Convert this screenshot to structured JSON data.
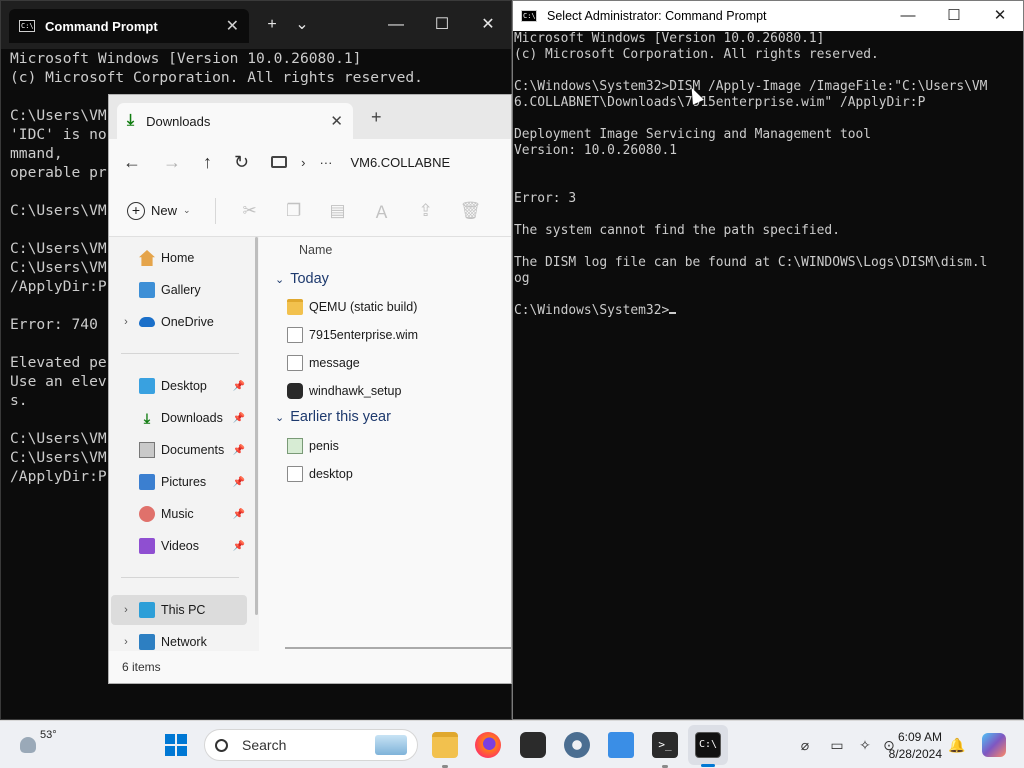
{
  "left_terminal": {
    "tab_title": "Command Prompt",
    "new_tab_glyph": "+",
    "dropdown_glyph": "⌄",
    "lines": [
      "Microsoft Windows [Version 10.0.26080.1]",
      "(c) Microsoft Corporation. All rights reserved.",
      "",
      "C:\\Users\\VM",
      "'IDC' is no",
      "mmand,",
      "operable pr",
      "",
      "C:\\Users\\VM",
      "",
      "C:\\Users\\VM",
      "C:\\Users\\VM",
      "/ApplyDir:P",
      "",
      "Error: 740",
      "",
      "Elevated pe",
      "Use an elev",
      "s.",
      "",
      "C:\\Users\\VM",
      "C:\\Users\\VM",
      "/ApplyDir:P"
    ]
  },
  "admin_console": {
    "title": "Select Administrator: Command Prompt",
    "lines": [
      "Microsoft Windows [Version 10.0.26080.1]",
      "(c) Microsoft Corporation. All rights reserved.",
      "",
      "C:\\Windows\\System32>DISM /Apply-Image /ImageFile:\"C:\\Users\\VM",
      "6.COLLABNET\\Downloads\\7915enterprise.wim\" /ApplyDir:P",
      "",
      "Deployment Image Servicing and Management tool",
      "Version: 10.0.26080.1",
      "",
      "",
      "Error: 3",
      "",
      "The system cannot find the path specified.",
      "",
      "The DISM log file can be found at C:\\WINDOWS\\Logs\\DISM\\dism.l",
      "og",
      "",
      "C:\\Windows\\System32>"
    ]
  },
  "explorer": {
    "tab_title": "Downloads",
    "breadcrumb": "VM6.COLLABNE",
    "more_glyph": "···",
    "new_label": "New",
    "column_name": "Name",
    "groups": [
      {
        "label": "Today",
        "items": [
          {
            "name": "QEMU (static build)",
            "icon": "folder-icon"
          },
          {
            "name": "7915enterprise.wim",
            "icon": "file-icon"
          },
          {
            "name": "message",
            "icon": "text-file-icon"
          },
          {
            "name": "windhawk_setup",
            "icon": "app-icon"
          }
        ]
      },
      {
        "label": "Earlier this year",
        "items": [
          {
            "name": "penis",
            "icon": "image-file-icon"
          },
          {
            "name": "desktop",
            "icon": "settings-file-icon"
          }
        ]
      }
    ],
    "nav": {
      "home": "Home",
      "gallery": "Gallery",
      "onedrive": "OneDrive",
      "desktop": "Desktop",
      "downloads": "Downloads",
      "documents": "Documents",
      "pictures": "Pictures",
      "music": "Music",
      "videos": "Videos",
      "thispc": "This PC",
      "network": "Network"
    },
    "status": "6 items"
  },
  "taskbar": {
    "temperature": "53°",
    "search_label": "Search",
    "time": "6:09 AM",
    "date": "8/28/2024"
  },
  "colors": {
    "console_bg": "#0c0c0c",
    "console_fg": "#cccccc",
    "accent": "#0078d4"
  }
}
